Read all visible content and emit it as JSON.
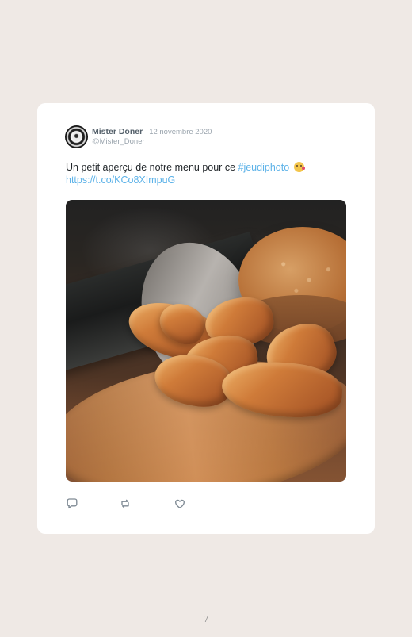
{
  "tweet": {
    "author_name": "Mister Döner",
    "separator": "·",
    "date": "12 novembre 2020",
    "handle": "@Mister_Doner",
    "text_prefix": "Un petit aperçu de notre menu pour ce ",
    "hashtag": "#jeudiphoto",
    "link": "https://t.co/KCo8XImpuG",
    "emoji": "winking-kiss-emoji"
  },
  "actions": [
    "reply-icon",
    "retweet-icon",
    "like-icon"
  ],
  "page": {
    "number": "7"
  },
  "colors": {
    "background": "#efe9e5",
    "card": "#ffffff",
    "link": "#5cb2e8",
    "text": "#1f2428",
    "muted": "#9aa4ad"
  }
}
